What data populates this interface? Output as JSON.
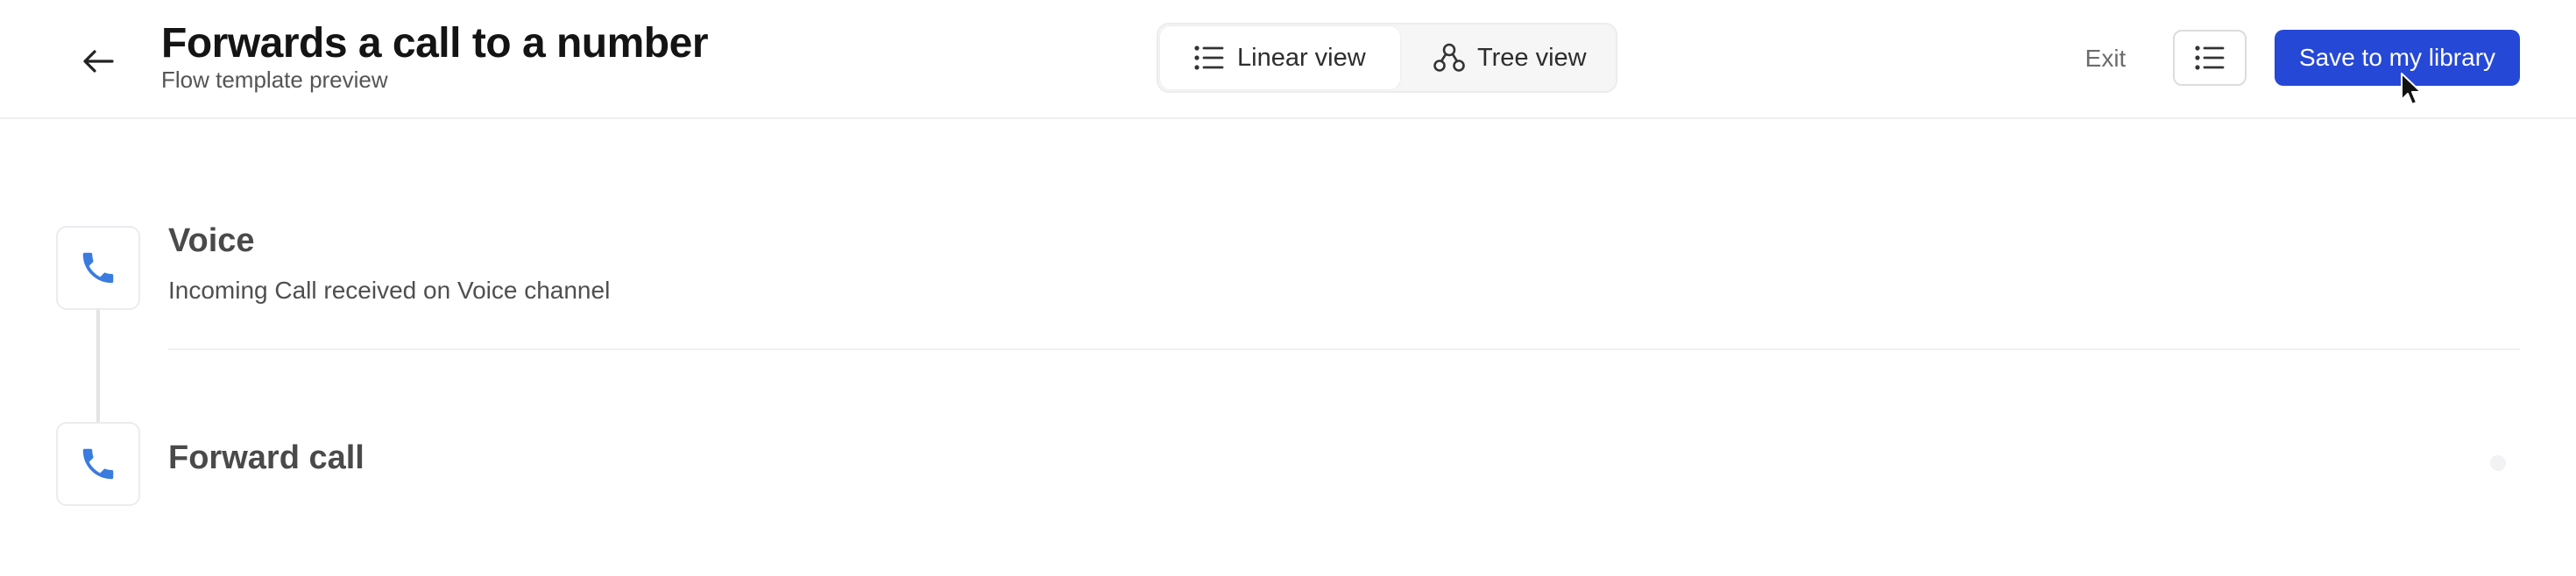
{
  "header": {
    "title": "Forwards a call to a number",
    "subtitle": "Flow template preview",
    "back_icon": "arrow-left-icon"
  },
  "view_toggle": {
    "tabs": [
      {
        "label": "Linear view",
        "icon": "list-icon",
        "active": true
      },
      {
        "label": "Tree view",
        "icon": "tree-nodes-icon",
        "active": false
      }
    ]
  },
  "actions": {
    "exit_label": "Exit",
    "list_icon": "list-icon",
    "save_label": "Save to my library"
  },
  "flow": {
    "steps": [
      {
        "title": "Voice",
        "description": "Incoming Call received on Voice channel",
        "icon": "phone-icon"
      },
      {
        "title": "Forward call",
        "icon": "phone-icon"
      }
    ]
  },
  "colors": {
    "accent": "#2548d6",
    "icon_blue": "#3a7be0"
  }
}
